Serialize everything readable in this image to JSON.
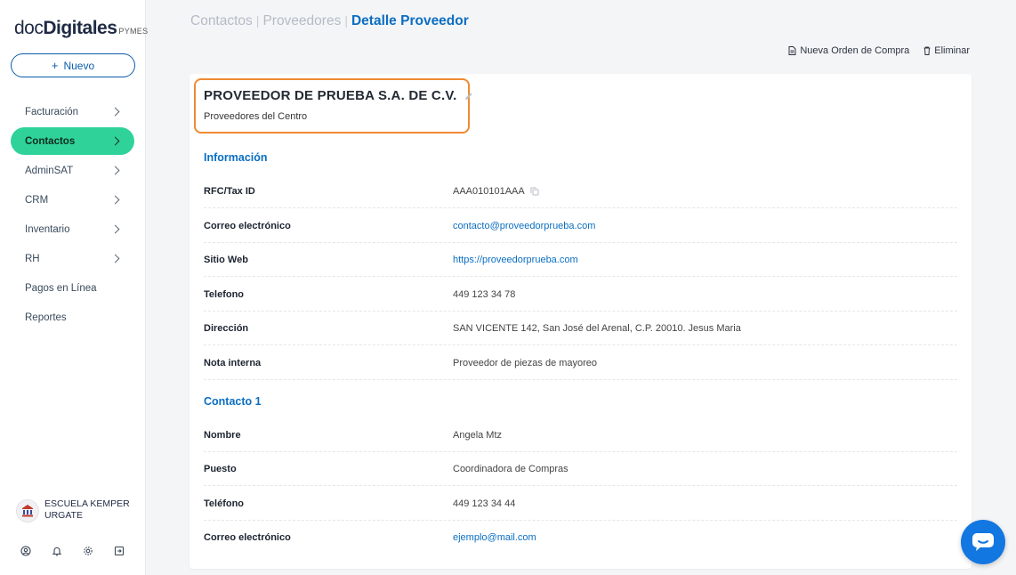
{
  "sidebar": {
    "logo": {
      "doc": "doc",
      "digitales": "Digitales",
      "pymes": "PYMES"
    },
    "new_button": "Nuevo",
    "items": [
      {
        "label": "Facturación",
        "active": false,
        "chevron": true
      },
      {
        "label": "Contactos",
        "active": true,
        "chevron": true
      },
      {
        "label": "AdminSAT",
        "active": false,
        "chevron": true
      },
      {
        "label": "CRM",
        "active": false,
        "chevron": true
      },
      {
        "label": "Inventario",
        "active": false,
        "chevron": true
      },
      {
        "label": "RH",
        "active": false,
        "chevron": true
      },
      {
        "label": "Pagos en Línea",
        "active": false,
        "chevron": false
      },
      {
        "label": "Reportes",
        "active": false,
        "chevron": false
      }
    ],
    "org_name": "ESCUELA KEMPER URGATE",
    "bottom_icons": [
      "user-circle-icon",
      "bell-icon",
      "gear-icon",
      "logout-icon"
    ]
  },
  "header": {
    "breadcrumb": {
      "item1": "Contactos",
      "item2": "Proveedores",
      "current": "Detalle Proveedor",
      "separator": "|"
    },
    "actions": {
      "new_order": "Nueva Orden de Compra",
      "delete": "Eliminar"
    }
  },
  "provider": {
    "name": "PROVEEDOR DE PRUEBA S.A. DE C.V.",
    "subtitle": "Proveedores del Centro"
  },
  "info_section": {
    "title": "Información",
    "rfc_label": "RFC/Tax ID",
    "rfc_value": "AAA010101AAA",
    "email_label": "Correo electrónico",
    "email_value": "contacto@proveedorprueba.com",
    "web_label": "Sitio Web",
    "web_value": "https://proveedorprueba.com",
    "phone_label": "Telefono",
    "phone_value": "449 123 34 78",
    "address_label": "Dirección",
    "address_value": "SAN VICENTE 142, San José del Arenal, C.P. 20010. Jesus Maria",
    "note_label": "Nota interna",
    "note_value": "Proveedor de piezas de mayoreo"
  },
  "contact_section": {
    "title": "Contacto 1",
    "name_label": "Nombre",
    "name_value": "Angela Mtz",
    "position_label": "Puesto",
    "position_value": "Coordinadora de Compras",
    "phone_label": "Teléfono",
    "phone_value": "449 123 34 44",
    "email_label": "Correo electrónico",
    "email_value": "ejemplo@mail.com"
  },
  "colors": {
    "brand_blue": "#0b6ec2",
    "active_green": "#2fd39a",
    "highlight_orange": "#ef8a33",
    "chat_blue": "#1277e1"
  }
}
